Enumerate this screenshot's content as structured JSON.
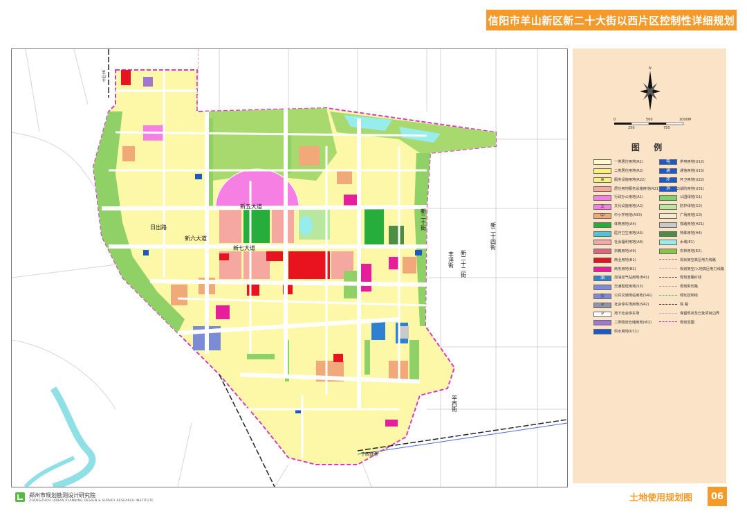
{
  "header": {
    "title": "信阳市羊山新区新二十大街以西片区控制性详细规划"
  },
  "footer": {
    "org_cn": "郑州市规划勘测设计研究院",
    "org_en": "ZHENGZHOU URBAN PLANNING DESIGN & SURVEY RESEARCH INSTITUTE",
    "map_title": "土地使用规划图",
    "page_number": "06"
  },
  "legend": {
    "title": "图 例",
    "scale_labels": [
      "0",
      "500",
      "1000M",
      "250",
      "750"
    ],
    "north_label": "N",
    "left_items": [
      {
        "label": "一类居住用地(R1)",
        "color": "#fdfbc8",
        "symbol": ""
      },
      {
        "label": "二类居住用地(R2)",
        "color": "#f7f07a",
        "symbol": ""
      },
      {
        "label": "服务设施用地(R22)",
        "color": "#f7f07a",
        "symbol": "⊕"
      },
      {
        "label": "居住用地服务设施用地(R21)(R21、R22)",
        "color": "#f5a8a0",
        "symbol": ""
      },
      {
        "label": "行政办公用地(A1)",
        "color": "#f57fe3",
        "symbol": ""
      },
      {
        "label": "文化设施用地(A2)",
        "color": "#f57fe3",
        "symbol": "文"
      },
      {
        "label": "中小学用地(A33)",
        "color": "#f1a97a",
        "symbol": "中"
      },
      {
        "label": "体育用地(A4)",
        "color": "#27ad3b",
        "symbol": ""
      },
      {
        "label": "医疗卫生用地(A5)",
        "color": "#48c7d4",
        "symbol": ""
      },
      {
        "label": "社会福利用地(A6)",
        "color": "#f5a7a5",
        "symbol": ""
      },
      {
        "label": "宗教用地(A9)",
        "color": "#d7697e",
        "symbol": ""
      },
      {
        "label": "商业用地(B1)",
        "color": "#e9121f",
        "symbol": ""
      },
      {
        "label": "商务用地(B2)",
        "color": "#e61e9b",
        "symbol": ""
      },
      {
        "label": "加油加气站用地(B41)",
        "color": "#2f80d1",
        "symbol": "油"
      },
      {
        "label": "交通枢纽用地(S3)",
        "color": "#7b8bd6",
        "symbol": ""
      },
      {
        "label": "公共交通场站用地(S41)",
        "color": "#7b8bd6",
        "symbol": "交"
      },
      {
        "label": "社会停车场用地(S42)",
        "color": "#9096a8",
        "symbol": "P"
      },
      {
        "label": "地下社会停车场",
        "color": "#ffffff",
        "symbol": "P"
      },
      {
        "label": "二类物流仓储用地(W2)",
        "color": "#a076d1",
        "symbol": ""
      },
      {
        "label": "供水用地(U11)",
        "color": "#1c59c6",
        "symbol": ""
      }
    ],
    "right_items": [
      {
        "label": "供电用地(U12)",
        "color": "#1c59c6",
        "symbol": "电"
      },
      {
        "label": "通信用地(U15)",
        "color": "#1c59c6",
        "symbol": "通"
      },
      {
        "label": "环卫用地(U22)",
        "color": "#1c59c6",
        "symbol": "环"
      },
      {
        "label": "消防用地(U31)",
        "color": "#1c59c6",
        "symbol": "消"
      },
      {
        "label": "公园绿地(G1)",
        "color": "#7fd36d",
        "symbol": ""
      },
      {
        "label": "防护绿地(G2)",
        "color": "#b8e8a0",
        "symbol": ""
      },
      {
        "label": "广场用地(G3)",
        "color": "#f3ecc8",
        "symbol": ""
      },
      {
        "label": "铁路用地(H21)",
        "color": "#c9c9c9",
        "symbol": ""
      },
      {
        "label": "特殊用地(H4)",
        "color": "#4e8e44",
        "symbol": ""
      },
      {
        "label": "水域(E1)",
        "color": "#97ecec",
        "symbol": ""
      },
      {
        "label": "农林用地(E2)",
        "color": "#8bc34a",
        "symbol": ""
      },
      {
        "label": "现状架空高压电力线路",
        "color": "#c06a9e",
        "symbol": "",
        "line": true
      },
      {
        "label": "规划架空/入地高压电力线路",
        "color": "#e6a1bd",
        "symbol": "",
        "line": true
      },
      {
        "label": "规划道路红线",
        "color": "#555555",
        "symbol": "",
        "line": true
      },
      {
        "label": "规划街坊路",
        "color": "#999999",
        "symbol": "",
        "line": true
      },
      {
        "label": "绿化控制线",
        "color": "#5abc5a",
        "symbol": "",
        "line": true
      },
      {
        "label": "铁 路",
        "color": "#222222",
        "symbol": "",
        "line": true
      },
      {
        "label": "保留现状及已批项目边界",
        "color": "#b9a4d6",
        "symbol": "",
        "line": true
      },
      {
        "label": "规划范围",
        "color": "#d33cc7",
        "symbol": "",
        "line": true
      }
    ]
  },
  "map": {
    "streets": [
      {
        "label": "羊山十",
        "orient": "v"
      },
      {
        "label": "新二十四街",
        "orient": "v"
      },
      {
        "label": "新二十二街",
        "orient": "v"
      },
      {
        "label": "新二十街",
        "orient": "v"
      },
      {
        "label": "丰洋街",
        "orient": "v"
      },
      {
        "label": "平西街",
        "orient": "v"
      },
      {
        "label": "新五大道",
        "orient": "h"
      },
      {
        "label": "新六大道",
        "orient": "h"
      },
      {
        "label": "新七大道",
        "orient": "h"
      },
      {
        "label": "日出路",
        "orient": "h"
      },
      {
        "label": "宁西铁路",
        "orient": "h"
      }
    ]
  }
}
